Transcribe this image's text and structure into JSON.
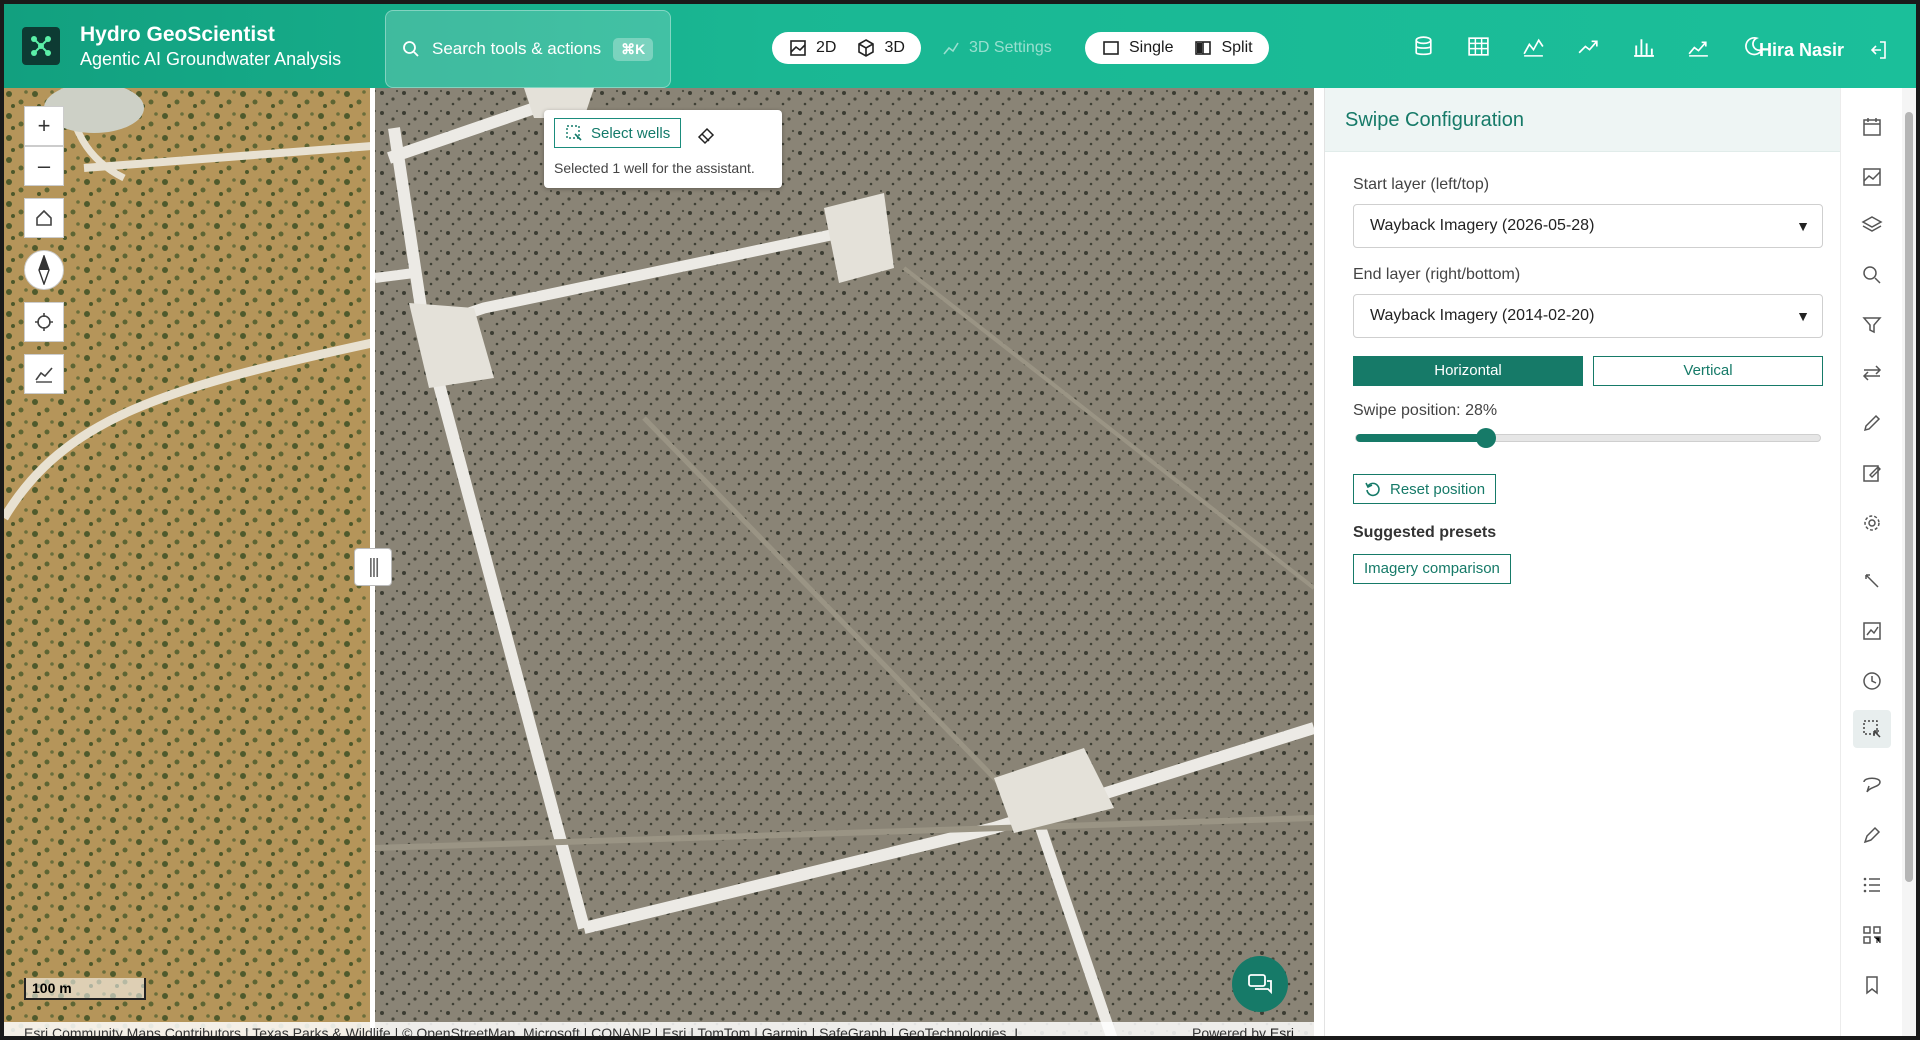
{
  "header": {
    "app_title": "Hydro GeoScientist",
    "app_subtitle": "Agentic AI Groundwater Analysis",
    "search_placeholder": "Search tools & actions",
    "search_shortcut": "⌘K",
    "view_2d": "2D",
    "view_3d": "3D",
    "settings_3d": "3D Settings",
    "layout_single": "Single",
    "layout_split": "Split",
    "user_name": "Hira Nasir",
    "brand_color": "#1ab793"
  },
  "map": {
    "select_wells_label": "Select wells",
    "select_note": "Selected 1 well for the assistant.",
    "scale_label": "100 m",
    "attribution": "Esri Community Maps Contributors | Texas Parks & Wildlife | © OpenStreetMap, Microsoft | CONANP | Esri | TomTom | Garmin | SafeGraph | GeoTechnologies, I...",
    "powered_prefix": "Powered by",
    "powered_link": "Esri"
  },
  "swipe_panel": {
    "title": "Swipe Configuration",
    "start_label": "Start layer (left/top)",
    "start_value": "Wayback Imagery (2026-05-28)",
    "end_label": "End layer (right/bottom)",
    "end_value": "Wayback Imagery (2014-02-20)",
    "orientation_horizontal": "Horizontal",
    "orientation_vertical": "Vertical",
    "orientation_selected": "Horizontal",
    "position_label": "Swipe position: 28%",
    "position_value": 0.28,
    "reset_label": "Reset position",
    "presets_heading": "Suggested presets",
    "preset_imagery": "Imagery comparison",
    "accent_color": "#167a68"
  }
}
